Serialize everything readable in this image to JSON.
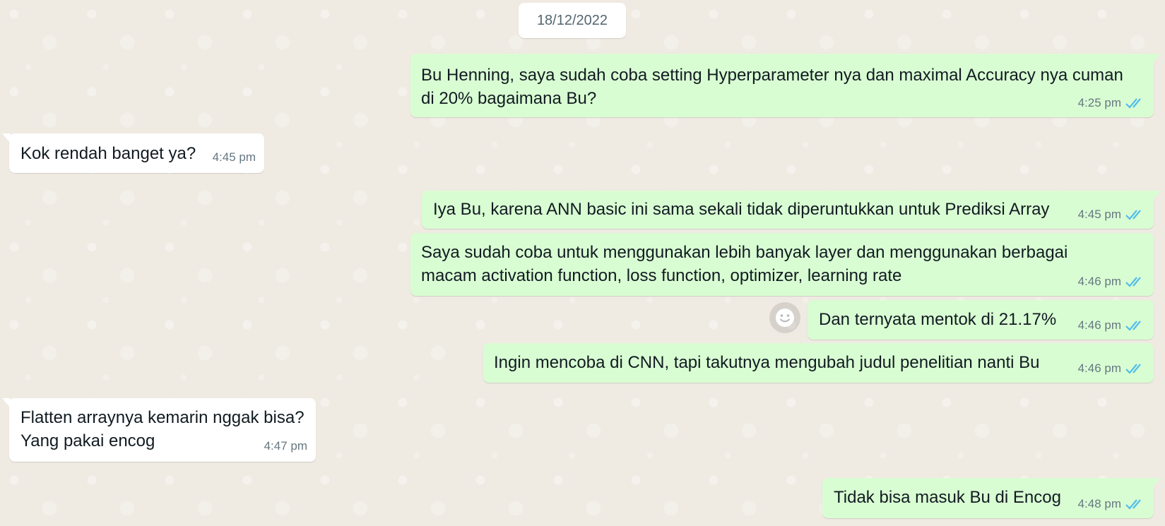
{
  "chat": {
    "date_chip": "18/12/2022",
    "messages": [
      {
        "direction": "outgoing",
        "lines": [
          "Bu Henning, saya sudah coba setting Hyperparameter nya dan maximal Accuracy nya cuman",
          "di 20% bagaimana Bu?"
        ],
        "time": "4:25 pm",
        "status": "read"
      },
      {
        "direction": "incoming",
        "lines": [
          "Kok rendah banget ya?"
        ],
        "time": "4:45 pm"
      },
      {
        "direction": "outgoing",
        "lines": [
          "Iya Bu, karena ANN basic ini sama sekali tidak diperuntukkan untuk Prediksi Array"
        ],
        "time": "4:45 pm",
        "status": "read"
      },
      {
        "direction": "outgoing",
        "lines": [
          "Saya sudah coba untuk menggunakan lebih banyak layer dan menggunakan berbagai",
          "macam activation function, loss function, optimizer, learning rate"
        ],
        "time": "4:46 pm",
        "status": "read"
      },
      {
        "direction": "outgoing",
        "lines": [
          "Dan ternyata mentok di 21.17%"
        ],
        "time": "4:46 pm",
        "status": "read"
      },
      {
        "direction": "outgoing",
        "lines": [
          "Ingin mencoba di CNN, tapi takutnya mengubah judul penelitian nanti Bu"
        ],
        "time": "4:46 pm",
        "status": "read"
      },
      {
        "direction": "incoming",
        "lines": [
          "Flatten arraynya kemarin nggak bisa?",
          "Yang pakai encog"
        ],
        "time": "4:47 pm"
      },
      {
        "direction": "outgoing",
        "lines": [
          "Tidak bisa masuk Bu di Encog"
        ],
        "time": "4:48 pm",
        "status": "read"
      }
    ]
  },
  "icons": {
    "read_receipt": "double-check-icon",
    "reaction": "smiley-icon"
  },
  "colors": {
    "background": "#efeae2",
    "outgoing_bubble": "#d9fdd3",
    "incoming_bubble": "#ffffff",
    "read_tick": "#53bdeb",
    "meta_text": "#667781",
    "message_text": "#111b21"
  }
}
